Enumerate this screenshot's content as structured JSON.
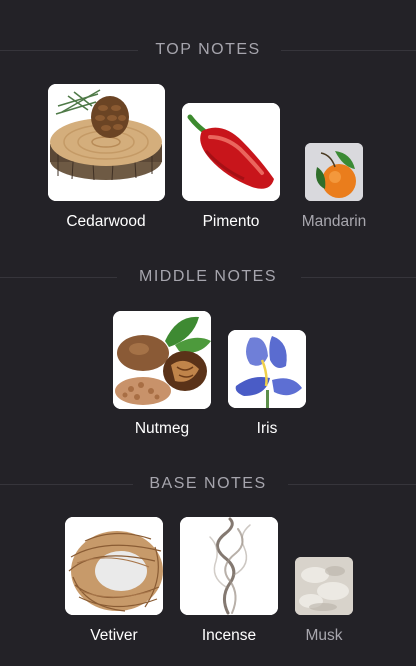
{
  "sections": [
    {
      "title": "TOP NOTES",
      "items": [
        {
          "label": "Cedarwood",
          "icon": "cedarwood-image"
        },
        {
          "label": "Pimento",
          "icon": "pimento-image"
        },
        {
          "label": "Mandarin",
          "icon": "mandarin-image"
        }
      ]
    },
    {
      "title": "MIDDLE NOTES",
      "items": [
        {
          "label": "Nutmeg",
          "icon": "nutmeg-image"
        },
        {
          "label": "Iris",
          "icon": "iris-image"
        }
      ]
    },
    {
      "title": "BASE NOTES",
      "items": [
        {
          "label": "Vetiver",
          "icon": "vetiver-image"
        },
        {
          "label": "Incense",
          "icon": "incense-image"
        },
        {
          "label": "Musk",
          "icon": "musk-image"
        }
      ]
    }
  ],
  "colors": {
    "background": "#232227",
    "section_title": "#a6a5ad",
    "label": "#ffffff",
    "label_dim": "#a8a7ae"
  }
}
